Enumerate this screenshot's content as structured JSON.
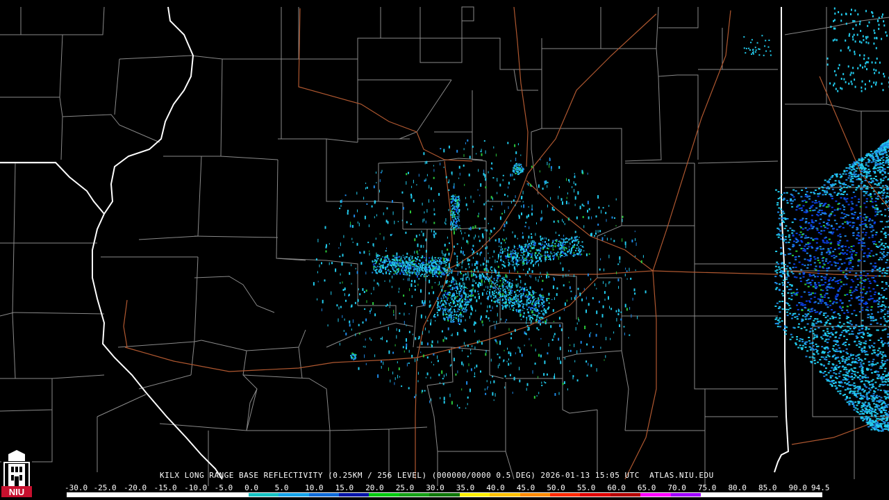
{
  "product": {
    "title": "KILX LONG RANGE BASE REFLECTIVITY (0.25KM / 256 LEVEL) (000000/0000 0.5 DEG) 2026-01-13 15:05 UTC  ATLAS.NIU.EDU"
  },
  "logo": {
    "text": "NIU",
    "icon": "niu-castle-icon",
    "colors": {
      "background": "#c8102e",
      "mark": "#ffffff"
    }
  },
  "scale": {
    "labels": [
      "-30.0",
      "-25.0",
      "-20.0",
      "-15.0",
      "-10.0",
      "-5.0",
      "0.0",
      "5.0",
      "10.0",
      "15.0",
      "20.0",
      "25.0",
      "30.0",
      "35.0",
      "40.0",
      "45.0",
      "50.0",
      "55.0",
      "60.0",
      "65.0",
      "70.0",
      "75.0",
      "80.0",
      "85.0",
      "90.0",
      "94.5"
    ],
    "colors": [
      "#ffffff",
      "#ffffff",
      "#ffffff",
      "#ffffff",
      "#ffffff",
      "#ffffff",
      "#17c3c3",
      "#16a4e9",
      "#0f6bd8",
      "#0414a8",
      "#02c810",
      "#16a017",
      "#0f7808",
      "#ffee00",
      "#ffc000",
      "#ff8a00",
      "#ff2a00",
      "#e00000",
      "#b50000",
      "#ff00ff",
      "#a000ff",
      "#ffffff",
      "#ffffff",
      "#ffffff",
      "#ffffff"
    ]
  },
  "map": {
    "colors": {
      "background": "#000000",
      "county_lines": "#8a8a8a",
      "state_lines": "#ffffff",
      "highways": "#b05830",
      "echo_light": "#22ccee",
      "echo_medium": "#1e88e5",
      "echo_strong": "#0a3ee0",
      "echo_green": "#2ac83a"
    }
  }
}
